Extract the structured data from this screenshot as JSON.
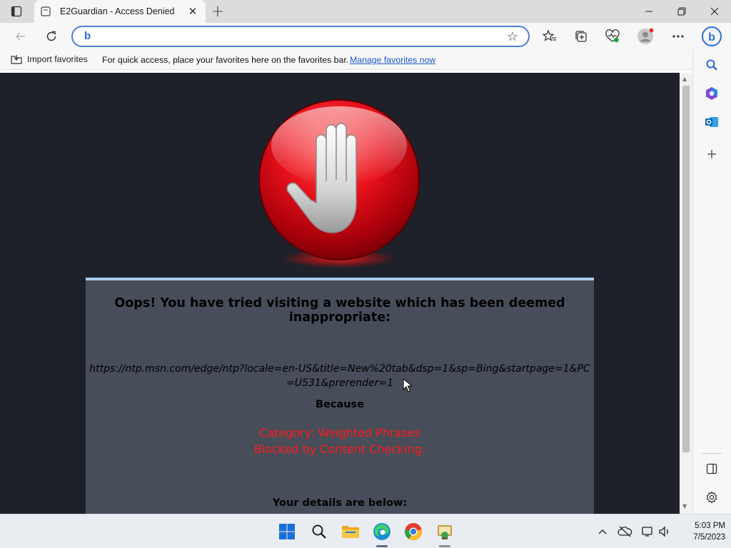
{
  "browser": {
    "tab": {
      "title": "E2Guardian - Access Denied"
    },
    "address": {
      "value": "",
      "placeholder": ""
    },
    "favorites_bar": {
      "import_label": "Import favorites",
      "message": "For quick access, place your favorites here on the favorites bar.",
      "manage_link": "Manage favorites now"
    }
  },
  "page": {
    "headline": "Oops! You have tried visiting a website which has been deemed inappropriate:",
    "blocked_url": "https://ntp.msn.com/edge/ntp?locale=en-US&title=New%20tab&dsp=1&sp=Bing&startpage=1&PC=U531&prerender=1",
    "because_label": "Because",
    "category_line": "Category: Weighted Phrases",
    "reason_line": "Blocked by Content Checking.",
    "details_label": "Your details are below:"
  },
  "taskbar": {
    "time": "5:03 PM",
    "date": "7/5/2023"
  },
  "colors": {
    "page_background": "#1e2129",
    "panel_background": "#474d59",
    "panel_border": "#a9cdee",
    "alert_text": "#ff1a1a",
    "link": "#1a56c9",
    "address_focus": "#4f7fd6"
  },
  "icons": {
    "tab_actions": "tab-actions-icon",
    "tab_favicon": "page-favicon-icon",
    "back": "back-arrow-icon",
    "refresh": "refresh-icon",
    "favorite_star": "star-icon",
    "favorites": "favorites-icon",
    "collections": "collections-icon",
    "browser_essentials": "heart-pulse-icon",
    "profile": "profile-avatar-icon",
    "more": "ellipsis-icon",
    "copilot": "bing-copilot-icon",
    "search": "search-icon",
    "office": "office-icon",
    "outlook": "outlook-icon",
    "add": "plus-icon",
    "sidebar_toggle": "sidebar-panel-icon",
    "settings": "gear-icon",
    "stop_hand": "stop-hand-icon"
  }
}
